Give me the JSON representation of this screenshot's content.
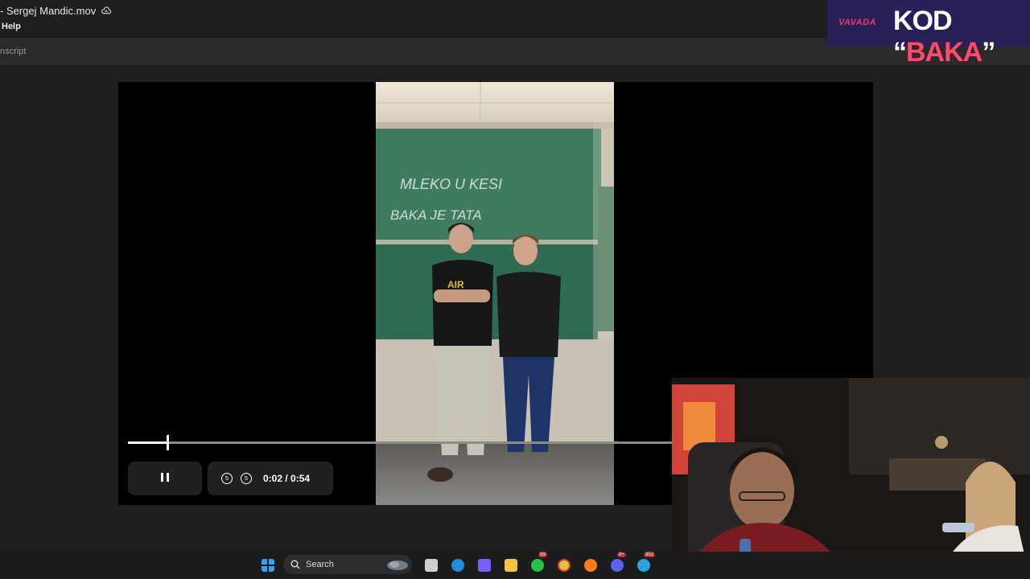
{
  "window": {
    "title": "- Sergej Mandic.mov",
    "menu": "Help",
    "toolbar_fragment": "nscript"
  },
  "video": {
    "board_line_1": "MLEKO U KESI",
    "board_line_2": "BAKA JE TATA",
    "shirt_text": "AIR",
    "time_display": "0:02 / 0:54",
    "progress": 0.07,
    "rewind_label": "5",
    "forward_label": "5"
  },
  "overlay": {
    "brand": "VAVADA",
    "code_prefix": "KOD “",
    "code_word": "BAKA",
    "code_suffix": "”"
  },
  "taskbar": {
    "search_label": "Search",
    "whatsapp_badge": "99",
    "discord_badge": "9+",
    "telegram_badge": "352"
  }
}
